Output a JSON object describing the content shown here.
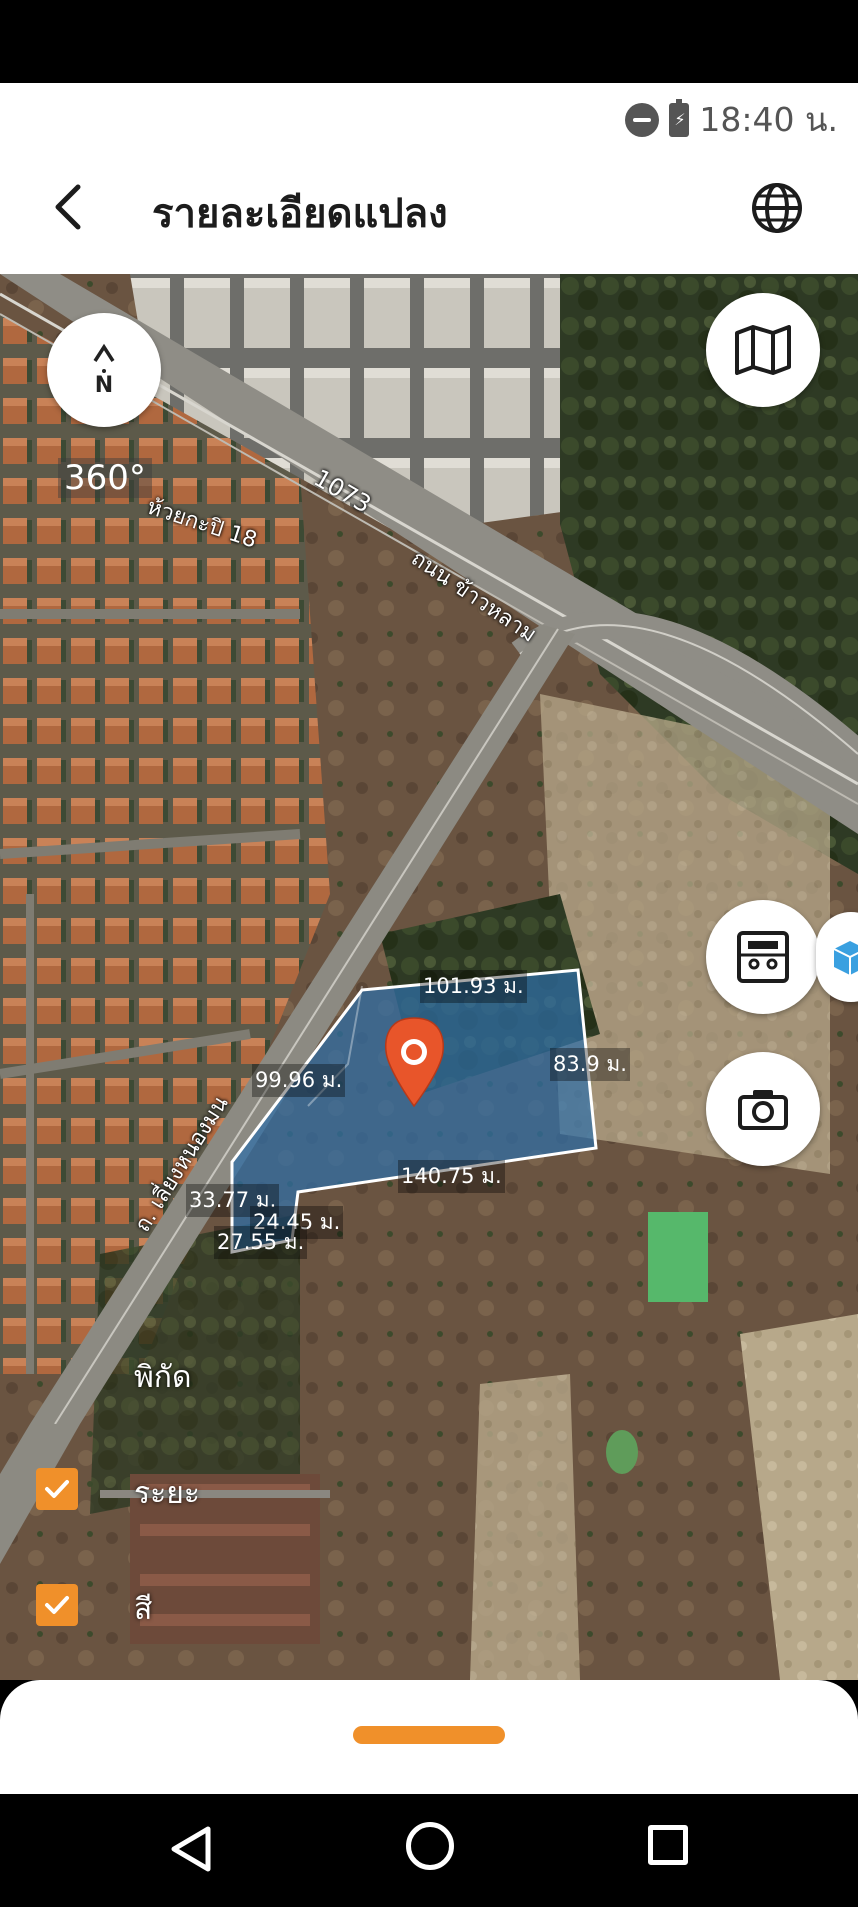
{
  "status_bar": {
    "time": "18:40 น."
  },
  "app_bar": {
    "title": "รายละเอียดแปลง",
    "back_icon": "back-arrow-icon",
    "language_icon": "globe-icon"
  },
  "map": {
    "compass_label": "N",
    "view_360_label": "360°",
    "road_labels": [
      "1073",
      "ห้วยกะปิ 18",
      "ถนน ข้าวหลาม",
      "ถ. เลี่ยงหนองมน"
    ],
    "plot_dimensions": [
      "101.93 ม.",
      "99.96 ม.",
      "83.9 ม.",
      "140.75 ม.",
      "33.77 ม.",
      "24.45 ม.",
      "27.55 ม."
    ],
    "overlay": {
      "coordinate_label": "พิกัด",
      "distance_label": "ระยะ",
      "color_label": "สี"
    },
    "buttons": {
      "map_layers_icon": "map-icon",
      "calculator_icon": "calculator-icon",
      "camera_icon": "camera-icon"
    },
    "colors": {
      "plot_fill": "#2f6fa8",
      "accent": "#f0902a",
      "pin": "#e8552a"
    }
  }
}
